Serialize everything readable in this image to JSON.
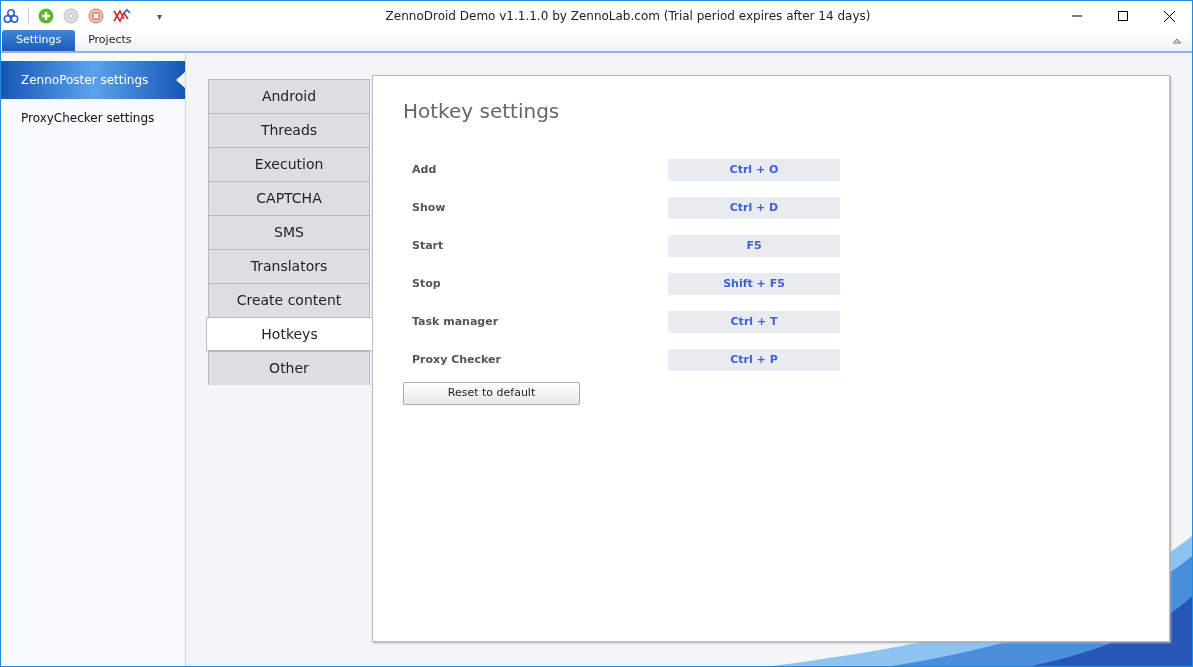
{
  "window": {
    "title": "ZennoDroid Demo v1.1.1.0 by ZennoLab.com (Trial period expires after 14 days)"
  },
  "toolbar_overflow": "▾",
  "ribbon_tabs": [
    {
      "label": "Settings",
      "selected": true
    },
    {
      "label": "Projects",
      "selected": false
    }
  ],
  "sidebar": {
    "items": [
      {
        "label": "ZennoPoster settings",
        "selected": true
      },
      {
        "label": "ProxyChecker settings",
        "selected": false
      }
    ]
  },
  "settings_tabs": [
    {
      "label": "Android",
      "selected": false
    },
    {
      "label": "Threads",
      "selected": false
    },
    {
      "label": "Execution",
      "selected": false
    },
    {
      "label": "CAPTCHA",
      "selected": false
    },
    {
      "label": "SMS",
      "selected": false
    },
    {
      "label": "Translators",
      "selected": false
    },
    {
      "label": "Create content",
      "selected": false
    },
    {
      "label": "Hotkeys",
      "selected": true
    },
    {
      "label": "Other",
      "selected": false
    }
  ],
  "panel": {
    "title": "Hotkey settings",
    "hotkeys": [
      {
        "label": "Add",
        "value": "Ctrl + O"
      },
      {
        "label": "Show",
        "value": "Ctrl + D"
      },
      {
        "label": "Start",
        "value": "F5"
      },
      {
        "label": "Stop",
        "value": "Shift + F5"
      },
      {
        "label": "Task manager",
        "value": "Ctrl + T"
      },
      {
        "label": "Proxy Checker",
        "value": "Ctrl + P"
      }
    ],
    "reset_button": "Reset to default"
  }
}
